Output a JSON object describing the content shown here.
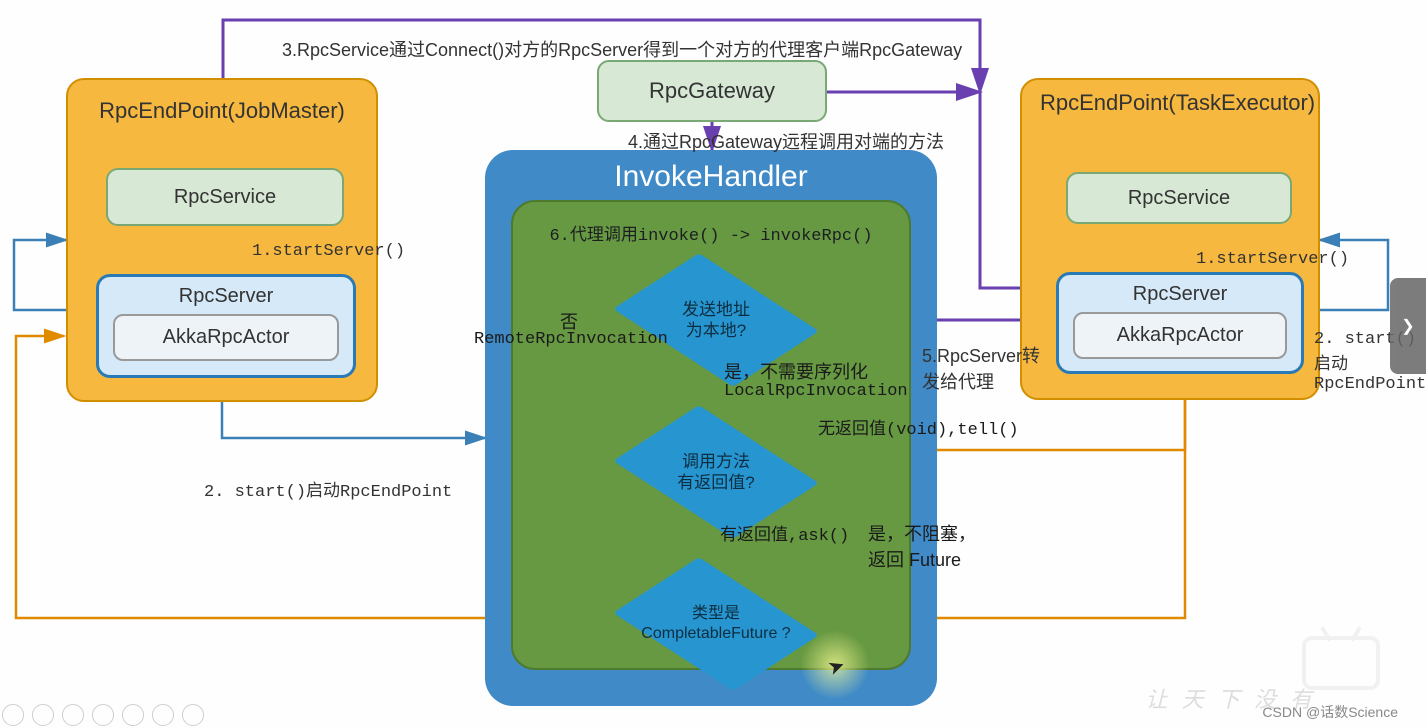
{
  "left_endpoint": {
    "title": "RpcEndPoint(JobMaster)",
    "service": "RpcService",
    "server": "RpcServer",
    "actor": "AkkaRpcActor"
  },
  "right_endpoint": {
    "title": "RpcEndPoint(TaskExecutor)",
    "service": "RpcService",
    "server": "RpcServer",
    "actor": "AkkaRpcActor"
  },
  "gateway": "RpcGateway",
  "handler": {
    "title": "InvokeHandler",
    "step6": "6.代理调用invoke() -> invokeRpc()",
    "d1": "发送地址\n为本地?",
    "d1_no": "否",
    "d1_no_sub": "RemoteRpcInvocation",
    "d1_yes": "是，不需要序列化",
    "d1_yes_sub": "LocalRpcInvocation",
    "d2": "调用方法\n有返回值?",
    "d2_void": "无返回值(void),tell()",
    "d2_ask": "有返回值,ask()",
    "d2_future": "是，不阻塞，\n返回 Future",
    "d3": "类型是\nCompletableFuture ?"
  },
  "labels": {
    "step1_l": "1.startServer()",
    "step1_r": "1.startServer()",
    "step2_l": "2. start()启动RpcEndPoint",
    "step2_r": "2. start()启动RpcEndPoint",
    "step3": "3.RpcService通过Connect()对方的RpcServer得到一个对方的代理客户端RpcGateway",
    "step4": "4.通过RpcGateway远程调用对端的方法",
    "step5": "5.RpcServer转发给代理"
  },
  "credit": "CSDN @话数Science"
}
